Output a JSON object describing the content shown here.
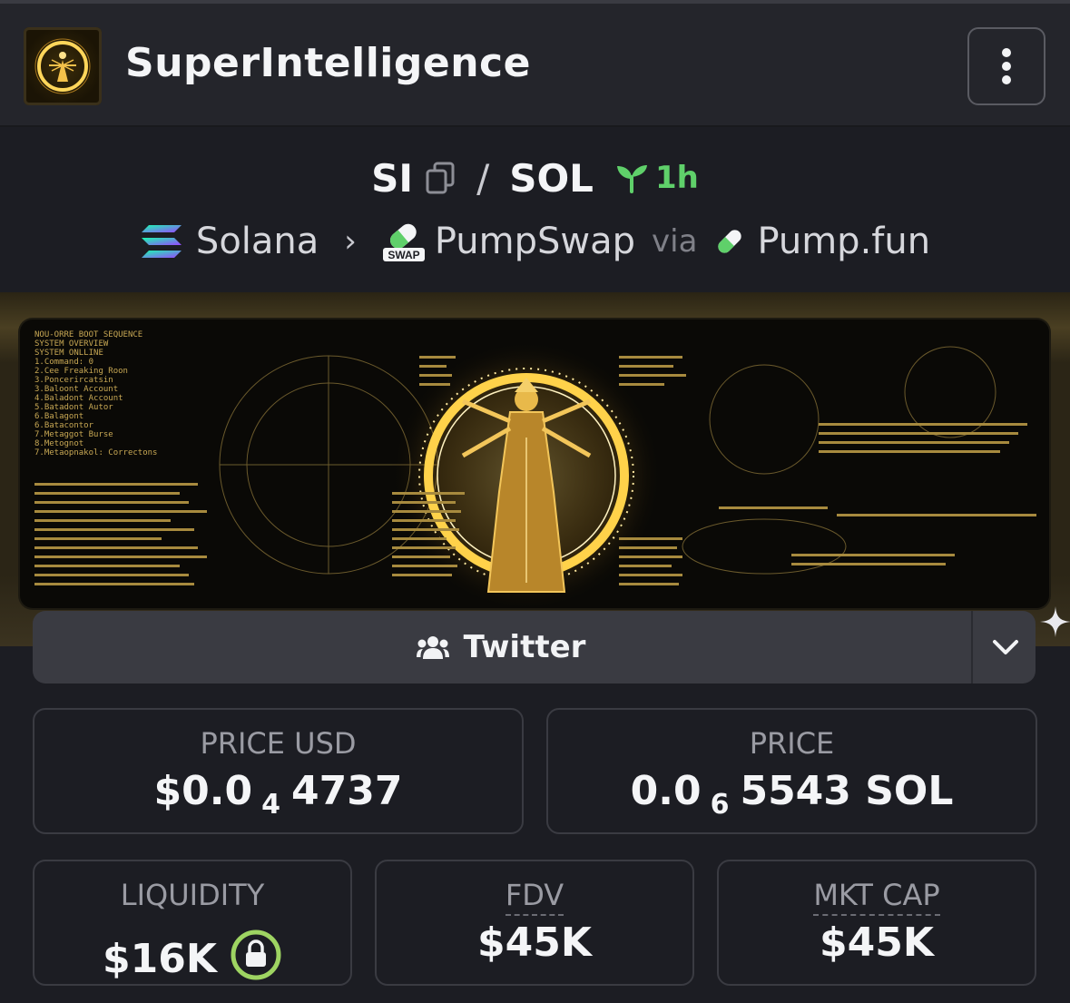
{
  "header": {
    "title": "SuperIntelligence",
    "menu_icon": "kebab-vertical-icon"
  },
  "pair": {
    "base": "SI",
    "separator": "/",
    "quote": "SOL",
    "age": "1h",
    "age_color": "#5fd06a"
  },
  "chain": {
    "network": "Solana",
    "chevron": "›",
    "dex": "PumpSwap",
    "dex_badge": "SWAP",
    "via": "via",
    "launchpad": "Pump.fun"
  },
  "banner": {
    "lines": [
      "NOU-ORRE BOOT SEQUENCE",
      "SYSTEM OVERVIEW",
      "SYSTEM ONLLINE",
      "1.Command: 0",
      "2.Cee Freaking Roon",
      "3.Poncerircatsin",
      "3.Baloont Account",
      "4.Baladont Account",
      "5.Batadont Autor",
      "6.Balagont",
      "6.Batacontor",
      "7.Metaggot Burse",
      "8.Metognot",
      "7.Metaopnakol: Correctons"
    ]
  },
  "social": {
    "label": "Twitter",
    "icon": "users-icon",
    "dropdown_icon": "chevron-down-icon"
  },
  "stats": {
    "price_usd": {
      "label": "PRICE USD",
      "prefix": "$0.0",
      "zeros": "4",
      "digits": "4737"
    },
    "price_native": {
      "label": "PRICE",
      "prefix": "0.0",
      "zeros": "6",
      "digits": "5543 SOL"
    },
    "liquidity": {
      "label": "LIQUIDITY",
      "value": "$16K",
      "lock_color": "#9ed462"
    },
    "fdv": {
      "label": "FDV",
      "value": "$45K"
    },
    "mkt_cap": {
      "label": "MKT CAP",
      "value": "$45K"
    }
  }
}
